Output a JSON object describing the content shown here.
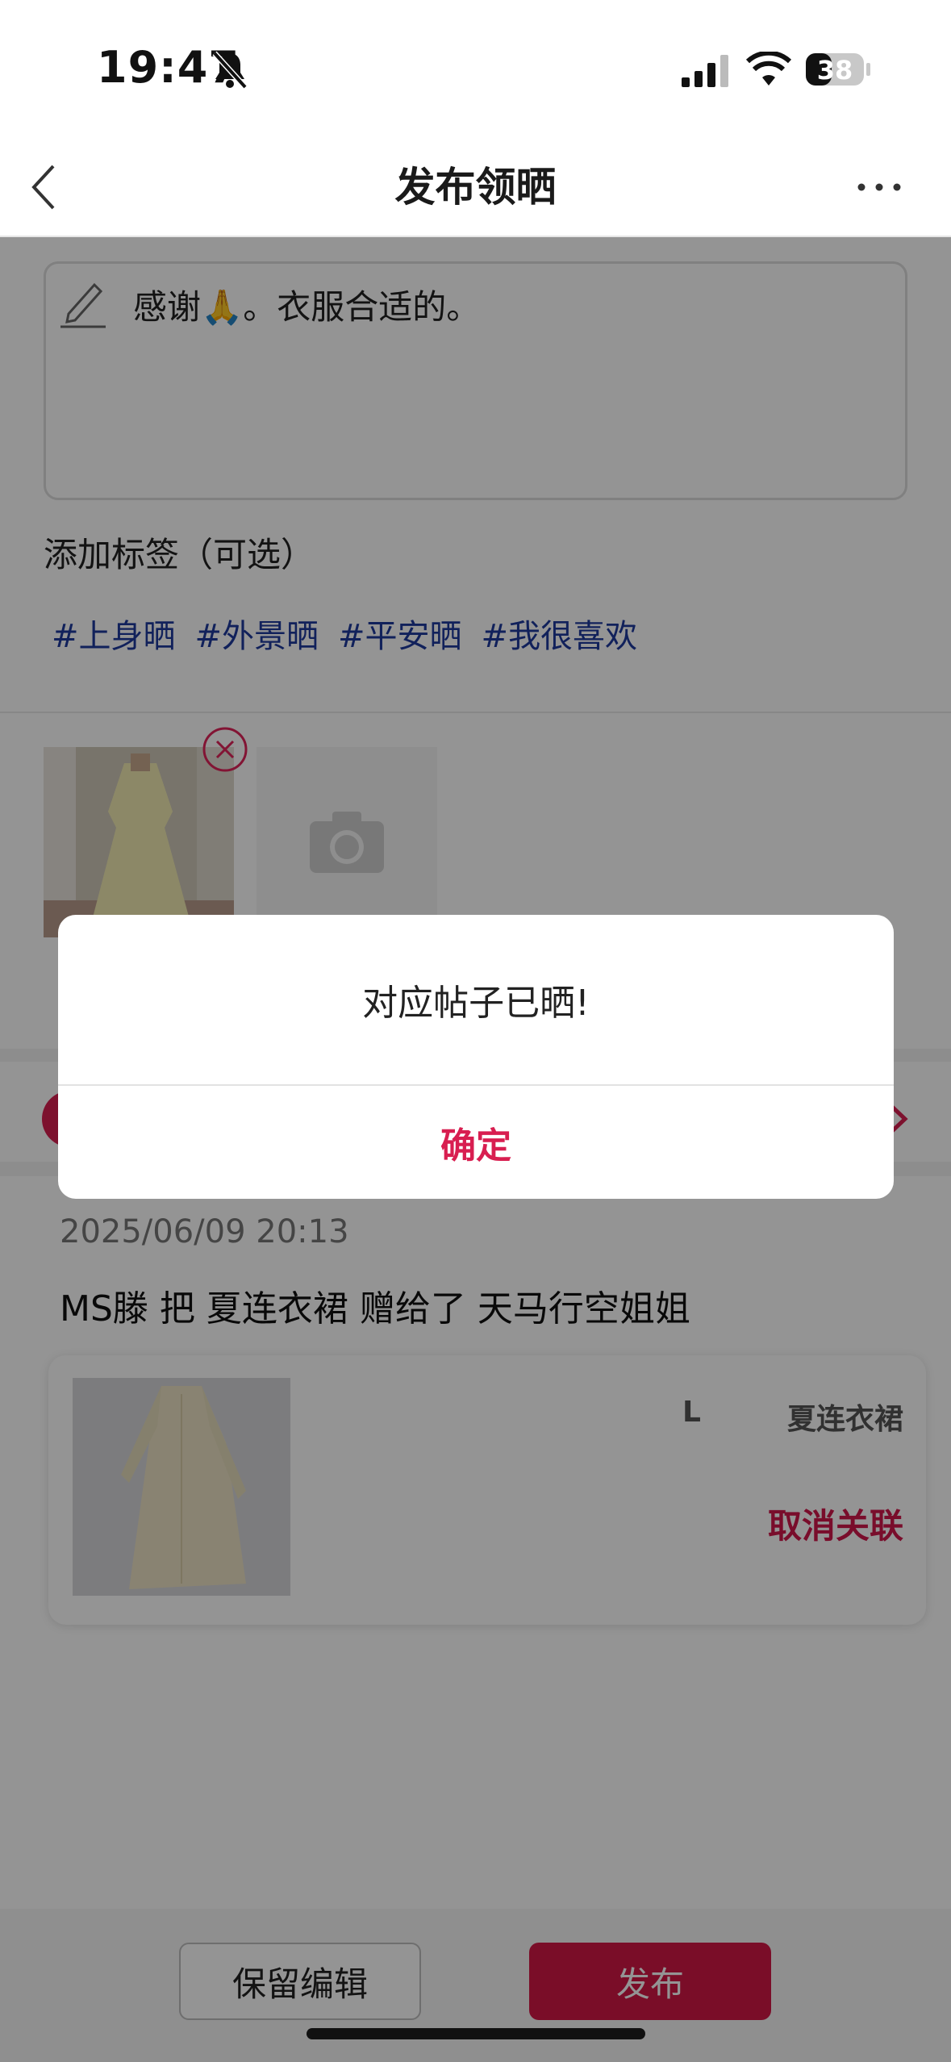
{
  "status_bar": {
    "time": "19:47",
    "battery": "38"
  },
  "nav": {
    "title": "发布领晒"
  },
  "post": {
    "text": "感谢🙏。衣服合适的。"
  },
  "tags": {
    "label": "添加标签（可选）",
    "items": [
      "#上身晒",
      "#外景晒",
      "#平安晒",
      "#我很喜欢"
    ]
  },
  "gift": {
    "date": "2025/06/09 20:13",
    "description": "MS滕 把 夏连衣裙 赠给了 天马行空姐姐",
    "size": "L",
    "item_name": "夏连衣裙",
    "unlink_label": "取消关联"
  },
  "dialog": {
    "message": "对应帖子已晒!",
    "confirm_label": "确定"
  },
  "bottom": {
    "keep_label": "保留编辑",
    "publish_label": "发布"
  },
  "colors": {
    "accent": "#d81e50",
    "tag": "#1e3a9e",
    "publish": "#d31746"
  },
  "icons": [
    "bell-slash-icon",
    "signal-icon",
    "wifi-icon",
    "battery-icon",
    "back-icon",
    "more-icon",
    "pen-icon",
    "remove-icon",
    "camera-icon",
    "chevron-right-icon"
  ]
}
